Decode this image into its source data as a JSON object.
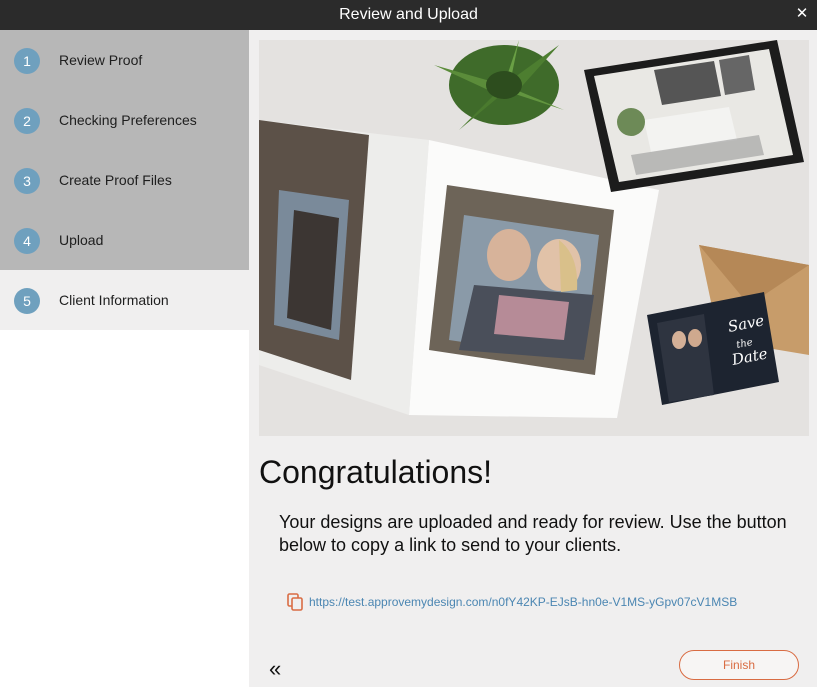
{
  "window": {
    "title": "Review and Upload",
    "close_glyph": "✕"
  },
  "steps": [
    {
      "number": "1",
      "label": "Review Proof"
    },
    {
      "number": "2",
      "label": "Checking Preferences"
    },
    {
      "number": "3",
      "label": "Create Proof Files"
    },
    {
      "number": "4",
      "label": "Upload"
    },
    {
      "number": "5",
      "label": "Client Information"
    }
  ],
  "main": {
    "heading": "Congratulations!",
    "message": "Your designs are uploaded and ready for review.  Use the button below to copy a link to send to your clients.",
    "link_url": "https://test.approvemydesign.com/n0fY42KP-EJsB-hn0e-V1MS-yGpv07cV1MSB",
    "copy_icon": "copy-icon",
    "back_glyph": "«",
    "finish_label": "Finish",
    "card_text": {
      "line1": "Save",
      "line2": "the",
      "line3": "Date"
    }
  },
  "colors": {
    "titlebar": "#2b2b2b",
    "step_badge": "#6fa0be",
    "sidebar_inactive": "#b7b7b7",
    "accent": "#d96c43",
    "link": "#4b86b2"
  }
}
